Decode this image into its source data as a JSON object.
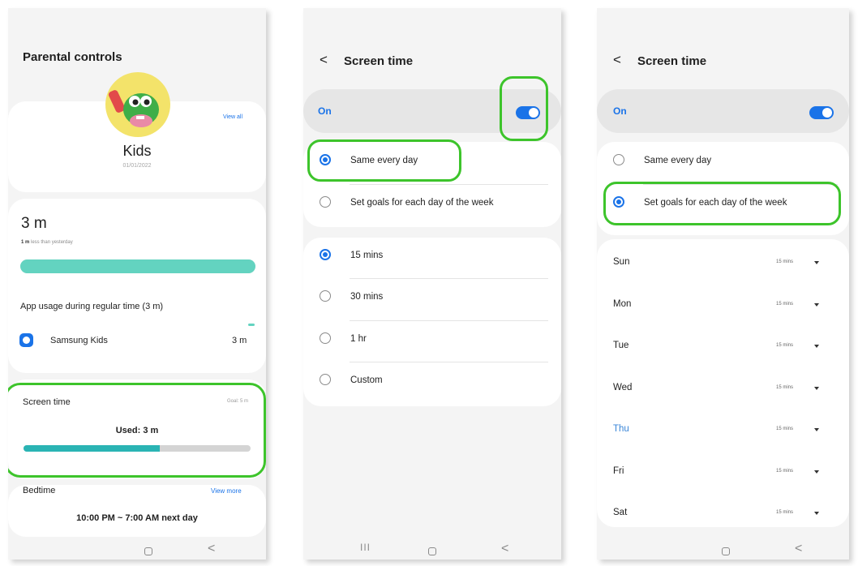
{
  "panel1": {
    "title": "Parental controls",
    "view_all": "View all",
    "profile_name": "Kids",
    "profile_date": "01/01/2022",
    "usage_value": "3 m",
    "usage_delta_bold": "1 m",
    "usage_delta_rest": "less than yesterday",
    "usage_bar_fraction": 1.0,
    "app_usage_title": "App usage during regular time (3 m)",
    "app_name": "Samsung Kids",
    "app_time": "3 m",
    "screen_time_label": "Screen time",
    "goal_label": "Goal: 5 m",
    "used_label": "Used: 3 m",
    "used_fraction": 0.6,
    "bedtime_label": "Bedtime",
    "view_more": "View more",
    "bedtime_value": "10:00 PM ~ 7:00 AM next day"
  },
  "panel2": {
    "back_glyph": "<",
    "title": "Screen time",
    "toggle_label": "On",
    "toggle_on": true,
    "schedule_options": [
      "Same every day",
      "Set goals for each day of the week"
    ],
    "schedule_selected": 0,
    "duration_options": [
      "15 mins",
      "30 mins",
      "1 hr",
      "Custom"
    ],
    "duration_selected": 0
  },
  "panel3": {
    "back_glyph": "<",
    "title": "Screen time",
    "toggle_label": "On",
    "toggle_on": true,
    "schedule_options": [
      "Same every day",
      "Set goals for each day of the week"
    ],
    "schedule_selected": 1,
    "days": [
      {
        "day": "Sun",
        "value": "15 mins"
      },
      {
        "day": "Mon",
        "value": "15 mins"
      },
      {
        "day": "Tue",
        "value": "15 mins"
      },
      {
        "day": "Wed",
        "value": "15 mins"
      },
      {
        "day": "Thu",
        "value": "15 mins"
      },
      {
        "day": "Fri",
        "value": "15 mins"
      },
      {
        "day": "Sat",
        "value": "15 mins"
      }
    ],
    "today_index": 4
  },
  "nav": {
    "recents_glyph": "III",
    "home_glyph": "",
    "back_glyph": "<"
  },
  "colors": {
    "highlight": "#3dc42b",
    "accent_blue": "#1a73e8",
    "today_blue": "#3a86d8",
    "usage_bar": "#63d3c0",
    "used_bar": "#2ab4b4",
    "toggle_bar_bg": "#e6e6e6"
  },
  "icons": {
    "avatar": "kids-dinosaur-avatar",
    "app": "samsung-kids-icon",
    "dropdown": "caret-down-icon",
    "back": "chevron-left-icon"
  }
}
